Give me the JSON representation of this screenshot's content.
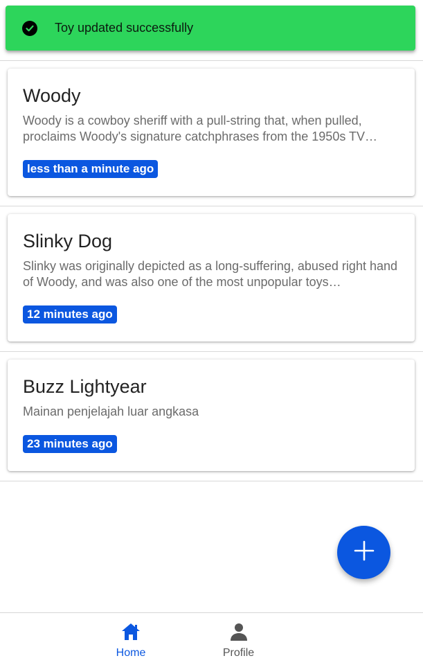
{
  "toast": {
    "message": "Toy updated successfully",
    "icon": "check-circle-icon"
  },
  "toys": [
    {
      "title": "Woody",
      "description": "Woody is a cowboy sheriff with a pull-string that, when pulled, proclaims Woody's signature catchphrases from the 1950s TV…",
      "time_ago": "less than a minute ago"
    },
    {
      "title": "Slinky Dog",
      "description": "Slinky was originally depicted as a long-suffering, abused right hand of Woody, and was also one of the most unpopular toys…",
      "time_ago": "12 minutes ago"
    },
    {
      "title": "Buzz Lightyear",
      "description": "Mainan penjelajah luar angkasa",
      "time_ago": "23 minutes ago"
    }
  ],
  "fab": {
    "icon": "plus-icon"
  },
  "nav": {
    "home_label": "Home",
    "profile_label": "Profile"
  },
  "colors": {
    "toast_bg": "#2dd55b",
    "accent": "#0b57e0"
  }
}
